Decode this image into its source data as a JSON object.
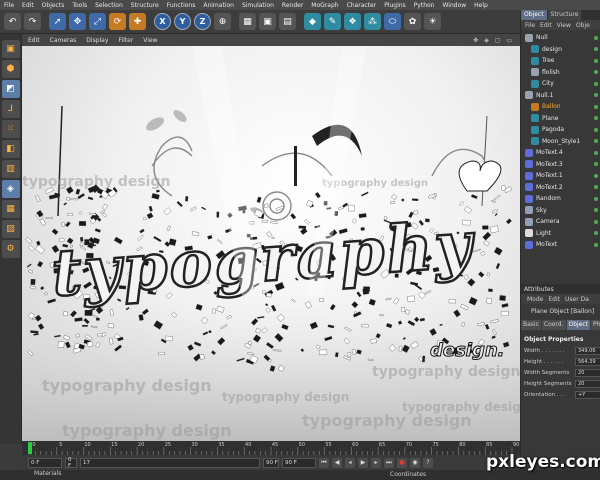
{
  "menu": [
    "File",
    "Edit",
    "Objects",
    "Tools",
    "Selection",
    "Structure",
    "Functions",
    "Animation",
    "Simulation",
    "Render",
    "MoGraph",
    "Character",
    "Plugins",
    "Python",
    "Window",
    "Help"
  ],
  "toolbar": {
    "buttons": [
      "undo-icon",
      "redo-icon",
      "live-selection-icon",
      "move-icon",
      "scale-icon",
      "rotate-icon",
      "add-icon",
      "x-axis-icon",
      "y-axis-icon",
      "z-axis-icon",
      "coordinate-system-icon",
      "render-view-icon",
      "render-picture-icon",
      "render-settings-icon",
      "cube-icon",
      "spline-icon",
      "nurbs-icon",
      "array-icon",
      "deformer-icon",
      "scene-icon",
      "light-icon"
    ],
    "axis_labels": [
      "X",
      "Y",
      "Z"
    ]
  },
  "left_tools": [
    "model-icon",
    "object-tool-icon",
    "texture-icon",
    "axis-icon",
    "points-icon",
    "edges-icon",
    "polygons-icon",
    "snap-icon",
    "workplane-icon",
    "tweak-icon",
    "plugin-icon"
  ],
  "viewport": {
    "menu": [
      "Edit",
      "Cameras",
      "Display",
      "Filter",
      "View"
    ],
    "nav_icons": "✥ ◈ ▢ ▭",
    "art": {
      "big_word": "typography",
      "small_word": "design.",
      "ghost_text": "typography design"
    }
  },
  "object_manager": {
    "tabs": [
      "Object",
      "Structure"
    ],
    "menu": [
      "File",
      "Edit",
      "View",
      "Obje"
    ],
    "objects": [
      {
        "name": "Null",
        "color": "#9aa3ad",
        "indent": 0
      },
      {
        "name": "design",
        "color": "#2f8ca0",
        "indent": 1
      },
      {
        "name": "Tree",
        "color": "#2f8ca0",
        "indent": 1
      },
      {
        "name": "flolish",
        "color": "#9aa3ad",
        "indent": 1
      },
      {
        "name": "City",
        "color": "#2f8ca0",
        "indent": 1
      },
      {
        "name": "Null.1",
        "color": "#9aa3ad",
        "indent": 0
      },
      {
        "name": "Ballon",
        "color": "#c67a23",
        "indent": 1,
        "selected": true
      },
      {
        "name": "Plane",
        "color": "#2f8ca0",
        "indent": 1
      },
      {
        "name": "Pagoda",
        "color": "#2f8ca0",
        "indent": 1
      },
      {
        "name": "Moon_Style1",
        "color": "#2f8ca0",
        "indent": 1
      },
      {
        "name": "MoText.4",
        "color": "#5f6dd8",
        "indent": 0
      },
      {
        "name": "MoText.3",
        "color": "#5f6dd8",
        "indent": 0
      },
      {
        "name": "MoText.1",
        "color": "#5f6dd8",
        "indent": 0
      },
      {
        "name": "MoText.2",
        "color": "#5f6dd8",
        "indent": 0
      },
      {
        "name": "Random",
        "color": "#5f6dd8",
        "indent": 0
      },
      {
        "name": "Sky",
        "color": "#8fa0b8",
        "indent": 0
      },
      {
        "name": "Camera",
        "color": "#8fa0b8",
        "indent": 0
      },
      {
        "name": "Light",
        "color": "#dddddd",
        "indent": 0
      },
      {
        "name": "MoText",
        "color": "#5f6dd8",
        "indent": 0
      }
    ]
  },
  "attributes": {
    "header": "Attributes",
    "menu": [
      "Mode",
      "Edit",
      "User Da"
    ],
    "title": "Plane Object [Ballon]",
    "tabs": [
      "Basic",
      "Coord.",
      "Object",
      "Ph"
    ],
    "section": "Object Properties",
    "props": [
      {
        "label": "Width . . . . . . .",
        "value": "349.06"
      },
      {
        "label": "Height . . . . . .",
        "value": "564.39"
      },
      {
        "label": "Width Segments",
        "value": "20"
      },
      {
        "label": "Height Segments",
        "value": "20"
      },
      {
        "label": "Orientation . . .",
        "value": "+Y"
      }
    ]
  },
  "timeline": {
    "ticks": [
      "0",
      "5",
      "10",
      "15",
      "20",
      "25",
      "30",
      "35",
      "40",
      "45",
      "50",
      "55",
      "60",
      "65",
      "70",
      "75",
      "80",
      "85",
      "90"
    ],
    "current_frame": "0 F",
    "start_field": "0 F",
    "end_field": "90 F",
    "min_field": "90 F",
    "scrub_value": "17"
  },
  "bottom": {
    "materials": "Materials",
    "coordinates": "Coordinates"
  },
  "watermark": "pxleyes.com"
}
